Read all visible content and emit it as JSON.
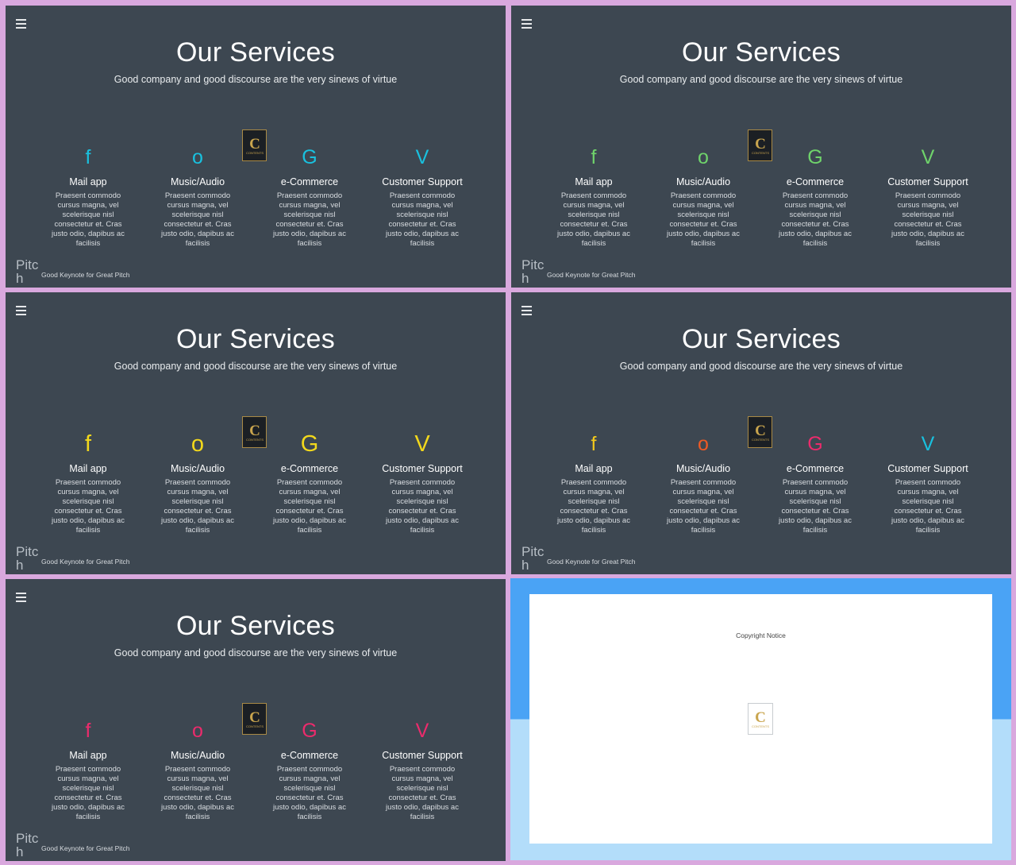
{
  "slides": [
    {
      "title": "Our Services",
      "subtitle": "Good company and good discourse are the very sinews of virtue",
      "pitch": "Pitch",
      "footer": "Good Keynote for Great Pitch",
      "services": [
        {
          "icon": "f",
          "title": "Mail app",
          "desc": "Praesent commodo cursus magna, vel scelerisque nisl consectetur et. Cras justo odio, dapibus ac facilisis",
          "color": "#19c1df"
        },
        {
          "icon": "o",
          "title": "Music/Audio",
          "desc": "Praesent commodo cursus magna, vel scelerisque nisl consectetur et. Cras justo odio, dapibus ac facilisis",
          "color": "#19c1df"
        },
        {
          "icon": "G",
          "title": "e-Commerce",
          "desc": "Praesent commodo cursus magna, vel scelerisque nisl consectetur et. Cras justo odio, dapibus ac facilisis",
          "color": "#19c1df"
        },
        {
          "icon": "V",
          "title": "Customer Support",
          "desc": "Praesent commodo cursus magna, vel scelerisque nisl consectetur et. Cras justo odio, dapibus ac facilisis",
          "color": "#19c1df"
        }
      ]
    },
    {
      "title": "Our Services",
      "subtitle": "Good company and good discourse are the very sinews of virtue",
      "pitch": "Pitch",
      "footer": "Good Keynote for Great Pitch",
      "services": [
        {
          "icon": "f",
          "title": "Mail app",
          "desc": "Praesent commodo cursus magna, vel scelerisque nisl consectetur et. Cras justo odio, dapibus ac facilisis",
          "color": "#6fd36b"
        },
        {
          "icon": "o",
          "title": "Music/Audio",
          "desc": "Praesent commodo cursus magna, vel scelerisque nisl consectetur et. Cras justo odio, dapibus ac facilisis",
          "color": "#6fd36b"
        },
        {
          "icon": "G",
          "title": "e-Commerce",
          "desc": "Praesent commodo cursus magna, vel scelerisque nisl consectetur et. Cras justo odio, dapibus ac facilisis",
          "color": "#6fd36b"
        },
        {
          "icon": "V",
          "title": "Customer Support",
          "desc": "Praesent commodo cursus magna, vel scelerisque nisl consectetur et. Cras justo odio, dapibus ac facilisis",
          "color": "#6fd36b"
        }
      ]
    },
    {
      "title": "Our Services",
      "subtitle": "Good company and good discourse are the very sinews of virtue",
      "pitch": "Pitch",
      "footer": "Good Keynote for Great Pitch",
      "services": [
        {
          "icon": "f",
          "title": "Mail app",
          "desc": "Praesent commodo cursus magna, vel scelerisque nisl consectetur et. Cras justo odio, dapibus ac facilisis",
          "color": "#f2d81c"
        },
        {
          "icon": "o",
          "title": "Music/Audio",
          "desc": "Praesent commodo cursus magna, vel scelerisque nisl consectetur et. Cras justo odio, dapibus ac facilisis",
          "color": "#f2d81c"
        },
        {
          "icon": "G",
          "title": "e-Commerce",
          "desc": "Praesent commodo cursus magna, vel scelerisque nisl consectetur et. Cras justo odio, dapibus ac facilisis",
          "color": "#f2d81c"
        },
        {
          "icon": "V",
          "title": "Customer Support",
          "desc": "Praesent commodo cursus magna, vel scelerisque nisl consectetur et. Cras justo odio, dapibus ac facilisis",
          "color": "#f2d81c"
        }
      ]
    },
    {
      "title": "Our Services",
      "subtitle": "Good company and good discourse are the very sinews of virtue",
      "pitch": "Pitch",
      "footer": "Good Keynote for Great Pitch",
      "services": [
        {
          "icon": "f",
          "title": "Mail app",
          "desc": "Praesent commodo cursus magna, vel scelerisque nisl consectetur et. Cras justo odio, dapibus ac facilisis",
          "color": "#f2c81c"
        },
        {
          "icon": "o",
          "title": "Music/Audio",
          "desc": "Praesent commodo cursus magna, vel scelerisque nisl consectetur et. Cras justo odio, dapibus ac facilisis",
          "color": "#ee5a25"
        },
        {
          "icon": "G",
          "title": "e-Commerce",
          "desc": "Praesent commodo cursus magna, vel scelerisque nisl consectetur et. Cras justo odio, dapibus ac facilisis",
          "color": "#ec2b6c"
        },
        {
          "icon": "V",
          "title": "Customer Support",
          "desc": "Praesent commodo cursus magna, vel scelerisque nisl consectetur et. Cras justo odio, dapibus ac facilisis",
          "color": "#19c1df"
        }
      ]
    },
    {
      "title": "Our Services",
      "subtitle": "Good company and good discourse are the very sinews of virtue",
      "pitch": "Pitch",
      "footer": "Good Keynote for Great Pitch",
      "services": [
        {
          "icon": "f",
          "title": "Mail app",
          "desc": "Praesent commodo cursus magna, vel scelerisque nisl consectetur et. Cras justo odio, dapibus ac facilisis",
          "color": "#ec2b6c"
        },
        {
          "icon": "o",
          "title": "Music/Audio",
          "desc": "Praesent commodo cursus magna, vel scelerisque nisl consectetur et. Cras justo odio, dapibus ac facilisis",
          "color": "#ec2b6c"
        },
        {
          "icon": "G",
          "title": "e-Commerce",
          "desc": "Praesent commodo cursus magna, vel scelerisque nisl consectetur et. Cras justo odio, dapibus ac facilisis",
          "color": "#ec2b6c"
        },
        {
          "icon": "V",
          "title": "Customer Support",
          "desc": "Praesent commodo cursus magna, vel scelerisque nisl consectetur et. Cras justo odio, dapibus ac facilisis",
          "color": "#ec2b6c"
        }
      ]
    }
  ],
  "badge": {
    "letter": "C",
    "word": "CONTENTS"
  },
  "copyright": {
    "text": "Copyright Notice"
  },
  "colors": {
    "slide_bg": "#3d4751",
    "page_bg": "#d9a8de",
    "badge_gold": "#c9a54e"
  }
}
